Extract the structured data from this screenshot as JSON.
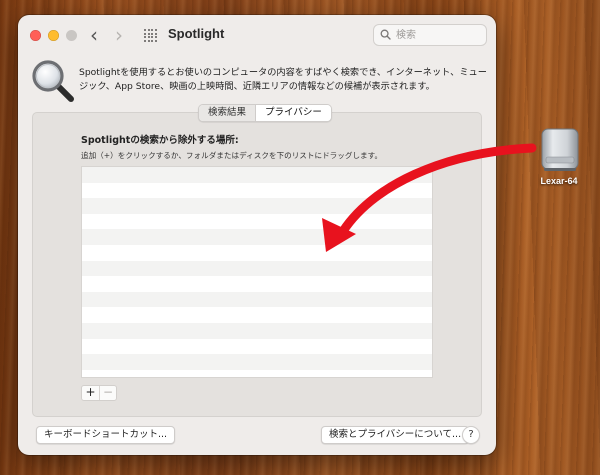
{
  "window": {
    "title": "Spotlight",
    "search_placeholder": "検索",
    "description": "Spotlightを使用するとお使いのコンピュータの内容をすばやく検索でき、インターネット、ミュージック、App Store、映画の上映時間、近隣エリアの情報などの候補が表示されます。"
  },
  "tabs": [
    {
      "label": "検索結果",
      "active": false
    },
    {
      "label": "プライバシー",
      "active": true
    }
  ],
  "privacy": {
    "section_title": "Spotlightの検索から除外する場所:",
    "instructions": "追加（+）をクリックするか、フォルダまたはディスクを下のリストにドラッグします。",
    "list_items": [],
    "add_label": "+",
    "remove_label": "−"
  },
  "buttons": {
    "keyboard_shortcuts": "キーボードショートカット...",
    "search_privacy": "検索とプライバシーについて...",
    "help": "?"
  },
  "desktop": {
    "drive_label": "Lexar-64"
  },
  "colors": {
    "close": "#ff5f57",
    "minimize": "#febc2e",
    "arrow": "#e8121e"
  },
  "icons": {
    "back": "chevron-left-icon",
    "forward": "chevron-right-icon",
    "grid": "grid-icon",
    "search": "search-icon",
    "spotlight": "magnifying-glass-icon",
    "drive": "external-drive-icon"
  }
}
